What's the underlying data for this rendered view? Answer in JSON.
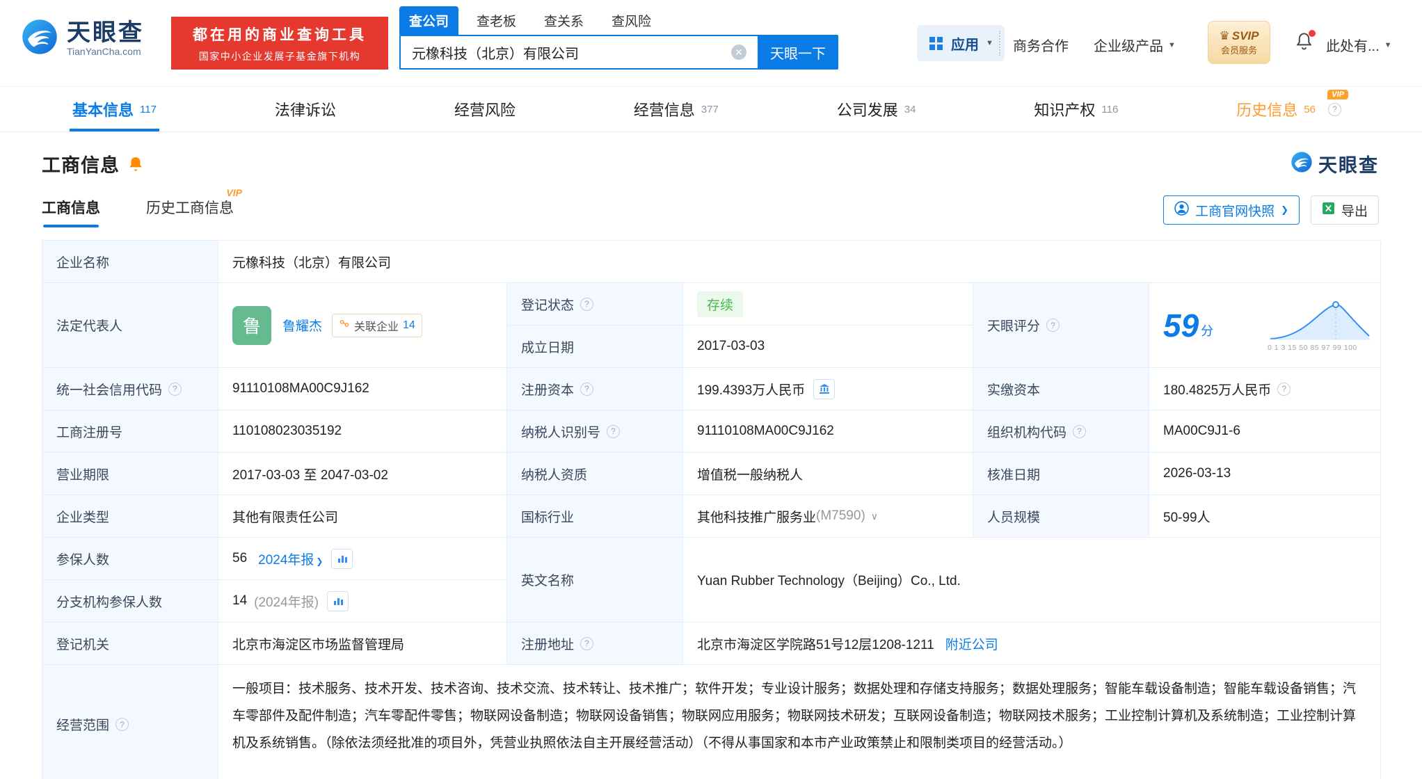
{
  "colors": {
    "accent": "#0b7ce6",
    "promo_red": "#e5382e",
    "vip_orange": "#ff9a2e",
    "status_green": "#49b84e",
    "navy": "#1b3c66"
  },
  "header": {
    "brand": "天眼查",
    "brand_domain": "TianYanCha.com",
    "promo_line1": "都在用的商业查询工具",
    "promo_line2": "国家中小企业发展子基金旗下机构",
    "search_tabs": [
      {
        "label": "查公司"
      },
      {
        "label": "查老板"
      },
      {
        "label": "查关系"
      },
      {
        "label": "查风险"
      }
    ],
    "search_value": "元橡科技（北京）有限公司",
    "search_button": "天眼一下",
    "apps_label": "应用",
    "coop_label": "商务合作",
    "enterprise_label": "企业级产品",
    "svip_line1": "SVIP",
    "svip_line2": "会员服务",
    "user_label": "此处有..."
  },
  "nav_tabs": [
    {
      "label": "基本信息",
      "count": "117"
    },
    {
      "label": "法律诉讼",
      "count": ""
    },
    {
      "label": "经营风险",
      "count": ""
    },
    {
      "label": "经营信息",
      "count": "377"
    },
    {
      "label": "公司发展",
      "count": "34"
    },
    {
      "label": "知识产权",
      "count": "116"
    },
    {
      "label": "历史信息",
      "count": "56",
      "vip": "VIP"
    }
  ],
  "section": {
    "title": "工商信息",
    "brand": "天眼查",
    "subtab_active": "工商信息",
    "subtab_history": "历史工商信息",
    "subtab_history_vip": "VIP",
    "snapshot_button": "工商官网快照",
    "export_button": "导出"
  },
  "fields": {
    "company_name": {
      "label": "企业名称",
      "value": "元橡科技（北京）有限公司"
    },
    "legal_rep": {
      "label": "法定代表人",
      "avatar": "鲁",
      "name": "鲁耀杰",
      "related_label": "关联企业",
      "related_count": "14"
    },
    "reg_status": {
      "label": "登记状态",
      "value": "存续"
    },
    "establish_date": {
      "label": "成立日期",
      "value": "2017-03-03"
    },
    "score": {
      "label": "天眼评分",
      "value": "59",
      "unit": "分",
      "axis": "0 1 3 15 50 85 97 99 100"
    },
    "credit_code": {
      "label": "统一社会信用代码",
      "value": "91110108MA00C9J162"
    },
    "reg_capital": {
      "label": "注册资本",
      "value": "199.4393万人民币"
    },
    "paid_capital": {
      "label": "实缴资本",
      "value": "180.4825万人民币"
    },
    "reg_number": {
      "label": "工商注册号",
      "value": "110108023035192"
    },
    "taxpayer_id": {
      "label": "纳税人识别号",
      "value": "91110108MA00C9J162"
    },
    "org_code": {
      "label": "组织机构代码",
      "value": "MA00C9J1-6"
    },
    "business_term": {
      "label": "营业期限",
      "value": "2017-03-03 至 2047-03-02"
    },
    "taxpayer_quality": {
      "label": "纳税人资质",
      "value": "增值税一般纳税人"
    },
    "approval_date": {
      "label": "核准日期",
      "value": "2026-03-13"
    },
    "company_type": {
      "label": "企业类型",
      "value": "其他有限责任公司"
    },
    "industry": {
      "label": "国标行业",
      "value": "其他科技推广服务业",
      "code": "(M7590)"
    },
    "staff_size": {
      "label": "人员规模",
      "value": "50-99人"
    },
    "insured": {
      "label": "参保人数",
      "value": "56",
      "report": "2024年报"
    },
    "branch_insured": {
      "label": "分支机构参保人数",
      "value": "14",
      "report": "(2024年报)"
    },
    "english_name": {
      "label": "英文名称",
      "value": "Yuan Rubber Technology（Beijing）Co., Ltd."
    },
    "reg_authority": {
      "label": "登记机关",
      "value": "北京市海淀区市场监督管理局"
    },
    "reg_address": {
      "label": "注册地址",
      "value": "北京市海淀区学院路51号12层1208-1211",
      "nearby": "附近公司"
    },
    "business_scope": {
      "label": "经营范围",
      "value": "一般项目：技术服务、技术开发、技术咨询、技术交流、技术转让、技术推广；软件开发；专业设计服务；数据处理和存储支持服务；数据处理服务；智能车载设备制造；智能车载设备销售；汽车零部件及配件制造；汽车零配件零售；物联网设备制造；物联网设备销售；物联网应用服务；物联网技术研发；互联网设备制造；物联网技术服务；工业控制计算机及系统制造；工业控制计算机及系统销售。（除依法须经批准的项目外，凭营业执照依法自主开展经营活动）（不得从事国家和本市产业政策禁止和限制类项目的经营活动。）"
    }
  }
}
